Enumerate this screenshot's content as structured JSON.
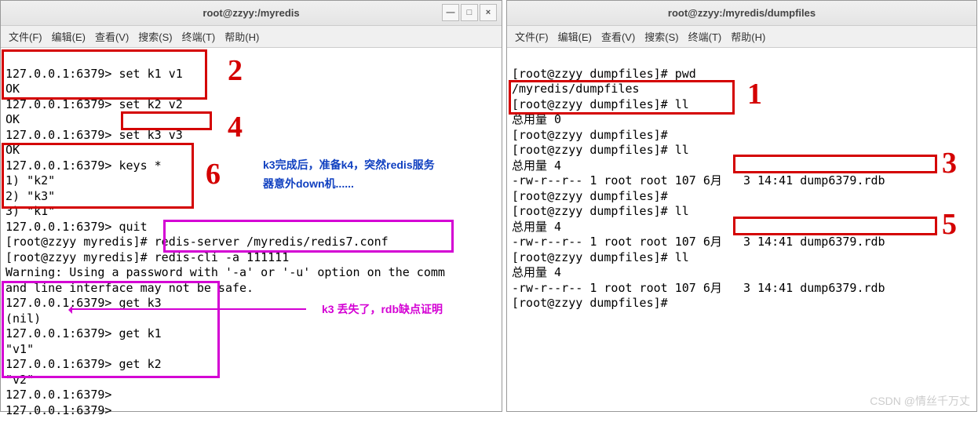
{
  "left": {
    "title": "root@zzyy:/myredis",
    "menu": [
      "文件(F)",
      "编辑(E)",
      "查看(V)",
      "搜索(S)",
      "终端(T)",
      "帮助(H)"
    ],
    "lines": [
      "127.0.0.1:6379> set k1 v1",
      "OK",
      "127.0.0.1:6379> set k2 v2",
      "OK",
      "127.0.0.1:6379> set k3 v3",
      "OK",
      "127.0.0.1:6379> keys *",
      "1) \"k2\"",
      "2) \"k3\"",
      "3) \"k1\"",
      "127.0.0.1:6379> quit",
      "[root@zzyy myredis]# redis-server /myredis/redis7.conf",
      "[root@zzyy myredis]# redis-cli -a 111111",
      "Warning: Using a password with '-a' or '-u' option on the comm",
      "and line interface may not be safe.",
      "127.0.0.1:6379> get k3",
      "(nil)",
      "127.0.0.1:6379> get k1",
      "\"v1\"",
      "127.0.0.1:6379> get k2",
      "\"v2\"",
      "127.0.0.1:6379>",
      "127.0.0.1:6379>"
    ]
  },
  "right": {
    "title": "root@zzyy:/myredis/dumpfiles",
    "menu": [
      "文件(F)",
      "编辑(E)",
      "查看(V)",
      "搜索(S)",
      "终端(T)",
      "帮助(H)"
    ],
    "lines": [
      "[root@zzyy dumpfiles]# pwd",
      "/myredis/dumpfiles",
      "[root@zzyy dumpfiles]# ll",
      "总用量 0",
      "[root@zzyy dumpfiles]#",
      "[root@zzyy dumpfiles]# ll",
      "总用量 4",
      "-rw-r--r-- 1 root root 107 6月   3 14:41 dump6379.rdb",
      "[root@zzyy dumpfiles]#",
      "[root@zzyy dumpfiles]# ll",
      "总用量 4",
      "-rw-r--r-- 1 root root 107 6月   3 14:41 dump6379.rdb",
      "[root@zzyy dumpfiles]# ll",
      "总用量 4",
      "-rw-r--r-- 1 root root 107 6月   3 14:41 dump6379.rdb",
      "[root@zzyy dumpfiles]#"
    ]
  },
  "controls": {
    "min": "—",
    "max": "□",
    "close": "×"
  },
  "annotations": {
    "n1": "1",
    "n2": "2",
    "n3": "3",
    "n4": "4",
    "n5": "5",
    "n6": "6",
    "blue1": "k3完成后，准备k4，突然redis服务",
    "blue2": "器意外down机......",
    "pink1": "k3 丢失了，rdb缺点证明"
  },
  "watermark": "CSDN @情丝千万丈"
}
